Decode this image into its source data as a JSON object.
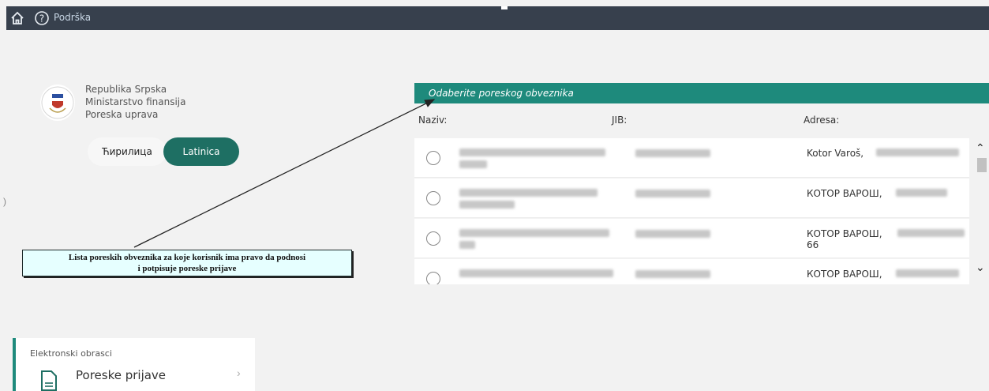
{
  "topbar": {
    "support_label": "Podrška",
    "home_icon": "home-icon",
    "help_icon": "help-circle-icon"
  },
  "brand": {
    "lines": [
      "Republika Srpska",
      "Ministarstvo finansija",
      "Poreska uprava"
    ]
  },
  "language": {
    "cyrillic": "Ћирилица",
    "latin": "Latinica",
    "active": "latin",
    "accent": "#1e6f63"
  },
  "callout": {
    "line1": "Lista poreskih obveznika za koje korisnik ima pravo da podnosi",
    "line2": "i potpisuje poreske prijave"
  },
  "taxpayers": {
    "header": "Odaberite poreskog obveznika",
    "header_color": "#1e8a7c",
    "columns": {
      "name": "Naziv:",
      "jib": "JIB:",
      "address": "Adresa:"
    },
    "rows": [
      {
        "address": "Kotor Varoš,",
        "address_line2": ""
      },
      {
        "address": "КОТОР ВАРОШ,",
        "address_line2": ""
      },
      {
        "address": "КОТОР ВАРОШ,",
        "address_line2": "66"
      },
      {
        "address": "КОТОР ВАРОШ,",
        "address_line2": ""
      }
    ]
  },
  "forms_card": {
    "section_label": "Elektronski obrasci",
    "title": "Poreske prijave"
  }
}
